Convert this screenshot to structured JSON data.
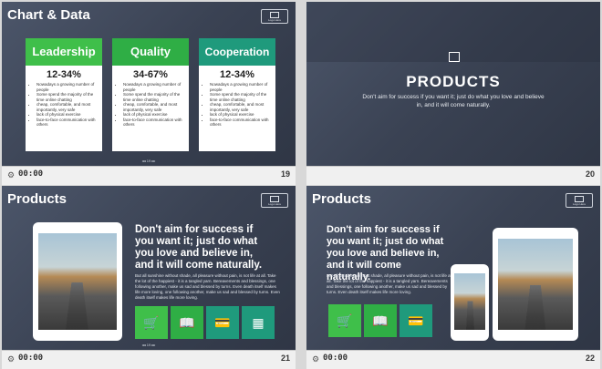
{
  "footer_time": "00:00",
  "logo_text": "Logo Here",
  "pager": "◂◂ 19 ▸▸",
  "slides": [
    {
      "number": "19",
      "title": "Chart & Data",
      "cards": [
        {
          "head": "Leadership",
          "pct": "12-34%",
          "color": "#3fbf4a",
          "bullets": [
            "Nowadays a growing number of people",
            "Some spend the majority of the time online chatting",
            "cheap, comfortable, and most importantly, very safe",
            "lack of physical exercise",
            "face-to-face communication with others"
          ]
        },
        {
          "head": "Quality",
          "pct": "34-67%",
          "color": "#2fae45",
          "bullets": [
            "Nowadays a growing number of people",
            "Some spend the majority of the time online chatting",
            "cheap, comfortable, and most importantly, very safe",
            "lack of physical exercise",
            "face-to-face communication with others"
          ]
        },
        {
          "head": "Cooperation",
          "pct": "12-34%",
          "color": "#1f9a7c",
          "bullets": [
            "Nowadays a growing number of people",
            "Some spend the majority of the time online chatting",
            "cheap, comfortable, and most importantly, very safe",
            "lack of physical exercise",
            "face-to-face communication with others"
          ]
        }
      ]
    },
    {
      "number": "20",
      "title": "PRODUCTS",
      "subtitle": "Don't aim for success if you want it; just do what you love and believe in, and it will come naturally."
    },
    {
      "number": "21",
      "title": "Products",
      "quote": "Don't aim for success if you want it; just do what you love and believe in, and it will come naturally.",
      "body": "But all sunshine without shade, all pleasure without pain, is not life at all. Take the lot of the happiest - it is a tangled yarn. Bereavements and blessings, one following another, make us sad and blessed by turns. Even death itself makes life more loving, one following another, make us sad and blessed by turns. Even death itself makes life more loving.",
      "tiles": [
        {
          "icon": "🛒",
          "color": "#3fbf4a"
        },
        {
          "icon": "📖",
          "color": "#2fae45"
        },
        {
          "icon": "💳",
          "color": "#1f9a7c"
        },
        {
          "icon": "▦",
          "color": "#1f9a7c"
        }
      ]
    },
    {
      "number": "22",
      "title": "Products",
      "quote": "Don't aim for success if you want it; just do what you love and believe in, and it will come naturally.",
      "body": "But all sunshine without shade, all pleasure without pain, is not life at all. Take the lot of the happiest - it is a tangled yarn. Bereavements and blessings, one following another, make us sad and blessed by turns. Even death itself makes life more loving.",
      "tiles": [
        {
          "icon": "🛒",
          "color": "#3fbf4a"
        },
        {
          "icon": "📖",
          "color": "#2fae45"
        },
        {
          "icon": "💳",
          "color": "#1f9a7c"
        }
      ]
    }
  ]
}
